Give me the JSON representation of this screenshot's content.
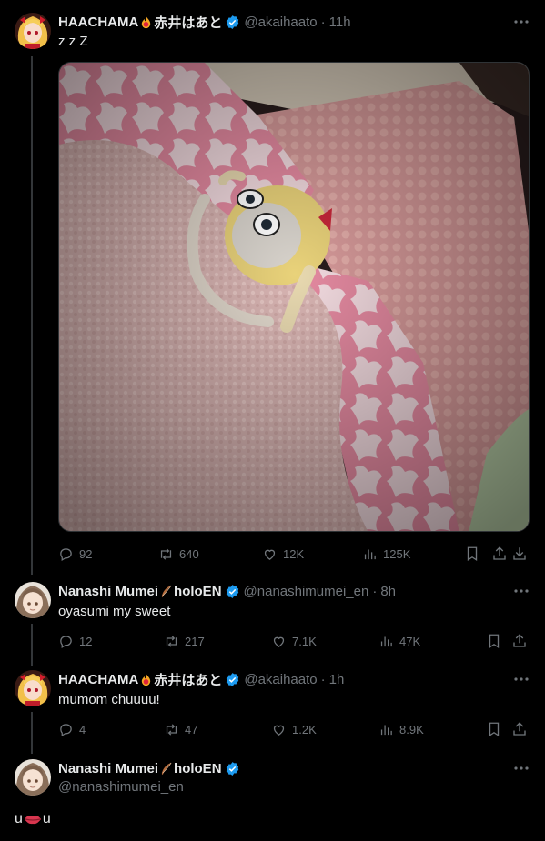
{
  "thread": [
    {
      "name": "HAACHAMA",
      "name_suffix": "赤井はあと",
      "handle": "@akaihaato",
      "time": "11h",
      "text": "z z Z",
      "stats": {
        "replies": "92",
        "reposts": "640",
        "likes": "12K",
        "views": "125K"
      }
    },
    {
      "name": "Nanashi Mumei",
      "name_suffix": "holoEN",
      "handle": "@nanashimumei_en",
      "time": "8h",
      "text": "oyasumi my sweet",
      "stats": {
        "replies": "12",
        "reposts": "217",
        "likes": "7.1K",
        "views": "47K"
      }
    },
    {
      "name": "HAACHAMA",
      "name_suffix": "赤井はあと",
      "handle": "@akaihaato",
      "time": "1h",
      "text": "mumom chuuuu!",
      "stats": {
        "replies": "4",
        "reposts": "47",
        "likes": "1.2K",
        "views": "8.9K"
      }
    }
  ],
  "reply_box": {
    "name": "Nanashi Mumei",
    "name_suffix": "holoEN",
    "handle": "@nanashimumei_en",
    "text_start": "u",
    "text_end": "u"
  },
  "colors": {
    "verified": "#1d9bf0",
    "secondary_text": "#71767b",
    "line": "#333639"
  },
  "icons": [
    "reply-icon",
    "repost-icon",
    "like-icon",
    "views-icon",
    "bookmark-icon",
    "share-icon",
    "download-icon",
    "more-icon",
    "verified-icon",
    "fire-emoji",
    "quill-emoji",
    "lips-emoji"
  ]
}
